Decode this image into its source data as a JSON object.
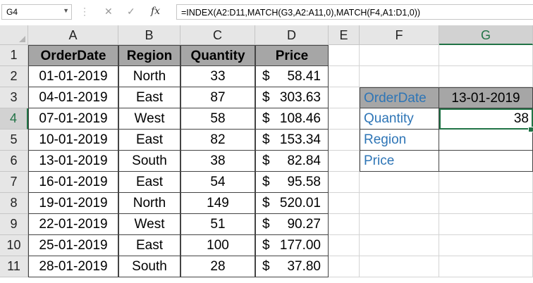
{
  "formula_bar": {
    "name_box": "G4",
    "cancel_glyph": "✕",
    "enter_glyph": "✓",
    "fx_glyph": "fx",
    "formula": "=INDEX(A2:D11,MATCH(G3,A2:A11,0),MATCH(F4,A1:D1,0))"
  },
  "columns": [
    "A",
    "B",
    "C",
    "D",
    "E",
    "F",
    "G"
  ],
  "rows": [
    "1",
    "2",
    "3",
    "4",
    "5",
    "6",
    "7",
    "8",
    "9",
    "10",
    "11"
  ],
  "table": {
    "headers": [
      "OrderDate",
      "Region",
      "Quantity",
      "Price"
    ],
    "currency": "$",
    "rows": [
      [
        "01-01-2019",
        "North",
        "33",
        "58.41"
      ],
      [
        "04-01-2019",
        "East",
        "87",
        "303.63"
      ],
      [
        "07-01-2019",
        "West",
        "58",
        "108.46"
      ],
      [
        "10-01-2019",
        "East",
        "82",
        "153.34"
      ],
      [
        "13-01-2019",
        "South",
        "38",
        "82.84"
      ],
      [
        "16-01-2019",
        "East",
        "54",
        "95.58"
      ],
      [
        "19-01-2019",
        "North",
        "149",
        "520.01"
      ],
      [
        "22-01-2019",
        "West",
        "51",
        "90.27"
      ],
      [
        "25-01-2019",
        "East",
        "100",
        "177.00"
      ],
      [
        "28-01-2019",
        "South",
        "28",
        "37.80"
      ]
    ]
  },
  "lookup": {
    "labels": [
      "OrderDate",
      "Quantity",
      "Region",
      "Price"
    ],
    "values": [
      "13-01-2019",
      "38",
      "",
      ""
    ]
  },
  "colors": {
    "accent": "#217346",
    "label_blue": "#2e75b6",
    "header_fill": "#a6a6a6"
  }
}
